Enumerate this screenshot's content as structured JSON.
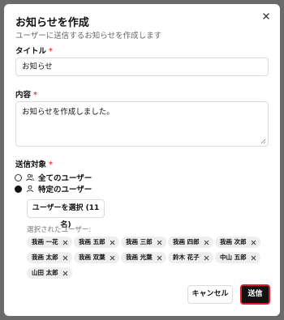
{
  "dialog": {
    "title": "お知らせを作成",
    "subtitle": "ユーザーに送信するお知らせを作成します"
  },
  "form": {
    "title_label": "タイトル",
    "title_value": "お知らせ",
    "content_label": "内容",
    "content_value": "お知らせを作成しました。",
    "required_mark": "*",
    "target_label": "送信対象",
    "options": [
      {
        "label": "全てのユーザー",
        "checked": false,
        "icon": "users-icon"
      },
      {
        "label": "特定のユーザー",
        "checked": true,
        "icon": "user-icon"
      }
    ],
    "select_button": "ユーザーを選択 (11名)",
    "selected_label": "選択されたユーザー:",
    "selected_users": [
      "我画 一花",
      "我画 五郎",
      "我画 三郎",
      "我画 四郎",
      "我画 次郎",
      "我画 太郎",
      "我画 双葉",
      "我画 光葉",
      "鈴木 花子",
      "中山 五郎",
      "山田 太郎"
    ]
  },
  "footer": {
    "cancel": "キャンセル",
    "send": "送信"
  },
  "colors": {
    "required": "#e0484a",
    "send_button_bg": "#111111",
    "send_button_outline": "#e01c24"
  }
}
